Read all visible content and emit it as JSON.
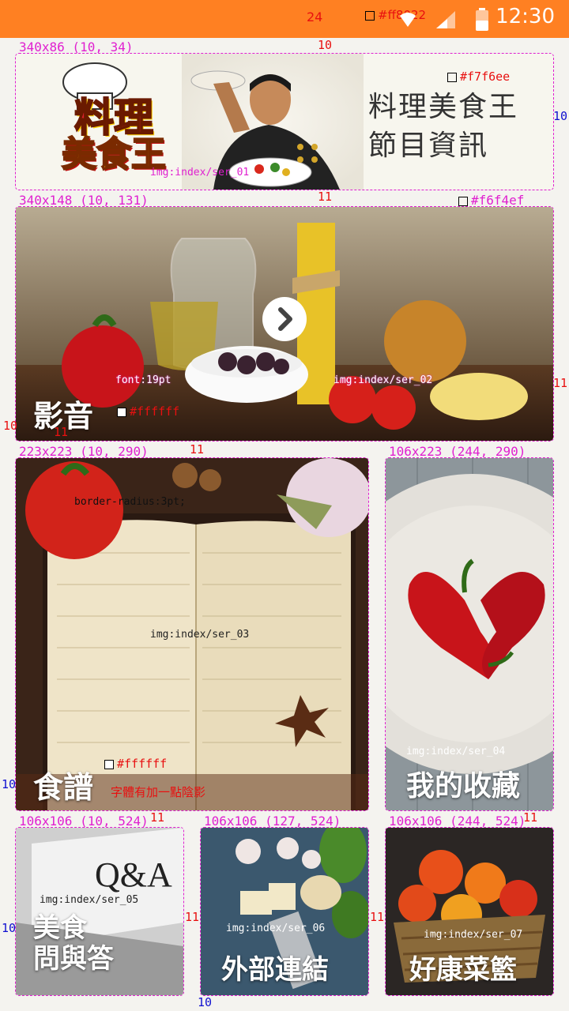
{
  "status": {
    "time": "12:30",
    "height_label": "24",
    "color_label": "#ff8022",
    "gap_label": "10"
  },
  "banner": {
    "size_label": "340x86 (10, 34)",
    "logo_line1": "料理",
    "logo_line2": "美食王",
    "title_line1": "料理美食王",
    "title_line2": "節目資訊",
    "bg_color_label": "#f7f6ee",
    "img_label": "img:index/ser_01",
    "right_label": "10",
    "bottom_gap": "11"
  },
  "video_tile": {
    "size_label": "340x148 (10, 131)",
    "color_label": "#f6f4ef",
    "label": "影音",
    "font_note": "font:19pt",
    "text_color_label": "#ffffff",
    "img_label": "img:index/ser_02",
    "left_label": "10",
    "inner_label": "11",
    "right_label": "11",
    "bottom_gap": "11"
  },
  "recipe_tile": {
    "size_label": "223x223 (10, 290)",
    "label": "食譜",
    "radius_note": "border-radius:3pt;",
    "img_label": "img:index/ser_03",
    "text_color_label": "#ffffff",
    "shadow_note": "字體有加一點陰影",
    "left_label": "10",
    "bottom_gap": "11"
  },
  "favorites_tile": {
    "size_label": "106x223 (244, 290)",
    "label": "我的收藏",
    "img_label": "img:index/ser_04",
    "right_gap": "11"
  },
  "qa_tile": {
    "size_label": "106x106 (10, 524)",
    "label_line1": "美食",
    "label_line2": "問與答",
    "img_label": "img:index/ser_05",
    "left_label": "10",
    "right_gap": "11"
  },
  "links_tile": {
    "size_label": "106x106 (127, 524)",
    "label": "外部連結",
    "img_label": "img:index/ser_06",
    "right_gap": "11",
    "bottom_label": "10"
  },
  "basket_tile": {
    "size_label": "106x106 (244, 524)",
    "label": "好康菜籃",
    "img_label": "img:index/ser_07"
  },
  "qa_text": "Q&A",
  "colors": {
    "status_bar": "#ff8022",
    "page_bg": "#f4f3ef",
    "guide": "#e020d0",
    "annotation_red": "#e81010"
  }
}
